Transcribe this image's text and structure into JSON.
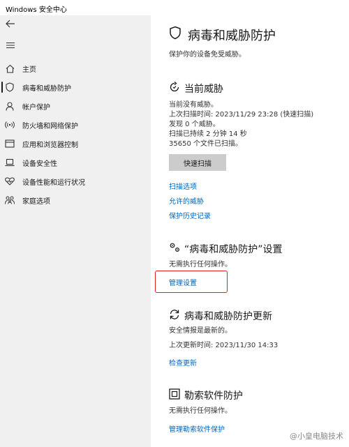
{
  "window": {
    "title": "Windows 安全中心"
  },
  "sidebar": {
    "items": [
      {
        "label": "主页",
        "icon": "home-icon"
      },
      {
        "label": "病毒和威胁防护",
        "icon": "shield-icon",
        "active": true
      },
      {
        "label": "帐户保护",
        "icon": "person-icon"
      },
      {
        "label": "防火墙和网络保护",
        "icon": "wifi-icon"
      },
      {
        "label": "应用和浏览器控制",
        "icon": "browser-icon"
      },
      {
        "label": "设备安全性",
        "icon": "laptop-icon"
      },
      {
        "label": "设备性能和运行状况",
        "icon": "heart-icon"
      },
      {
        "label": "家庭选项",
        "icon": "family-icon"
      }
    ]
  },
  "main": {
    "title": "病毒和威胁防护",
    "subtitle": "保护你的设备免受威胁。",
    "current_threats": {
      "heading": "当前威胁",
      "lines": [
        "当前没有威胁。",
        "上次扫描时间: 2023/11/29 23:28 (快速扫描)",
        "发现 0 个威胁。",
        "扫描已持续 2 分钟 14 秒",
        "35650 个文件已扫描。"
      ],
      "quick_scan_label": "快速扫描",
      "links": [
        "扫描选项",
        "允许的威胁",
        "保护历史记录"
      ]
    },
    "settings": {
      "heading": "“病毒和威胁防护”设置",
      "text": "无需执行任何操作。",
      "link": "管理设置"
    },
    "updates": {
      "heading": "病毒和威胁防护更新",
      "lines": [
        "安全情报是最新的。",
        "上次更新时间: 2023/11/30 14:33"
      ],
      "link": "检查更新"
    },
    "ransomware": {
      "heading": "勒索软件防护",
      "text": "无需执行任何操作。",
      "link": "管理勒索软件保护"
    }
  },
  "watermark": "@小皇电脑技术",
  "colors": {
    "link": "#0067c0",
    "highlight_box": "#e02020",
    "sidebar_bg": "#f0f0f0",
    "button_bg": "#cccccc"
  }
}
